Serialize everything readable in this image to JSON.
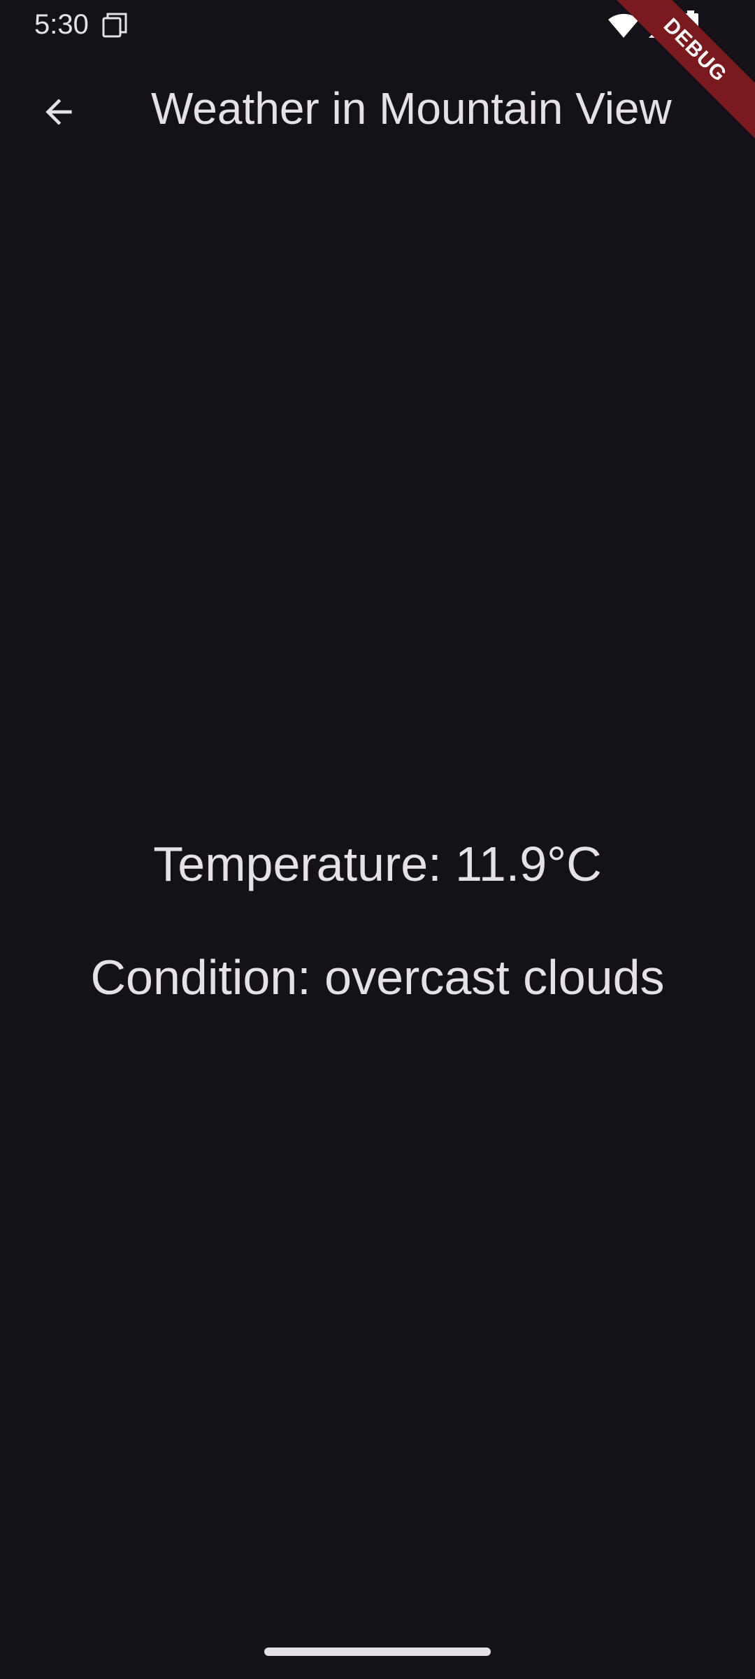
{
  "status_bar": {
    "time": "5:30",
    "icons": [
      "notification-icon",
      "wifi-icon",
      "signal-icon",
      "battery-icon"
    ]
  },
  "app_bar": {
    "back_icon": "arrow-back-icon",
    "title": "Weather in Mountain View"
  },
  "debug_banner": {
    "label": "DEBUG",
    "color": "#7A1A1E"
  },
  "weather": {
    "temperature_text": "Temperature: 11.9°C",
    "condition_text": "Condition: overcast clouds"
  },
  "theme": {
    "background": "#141218",
    "text": "#E6E0E9"
  }
}
